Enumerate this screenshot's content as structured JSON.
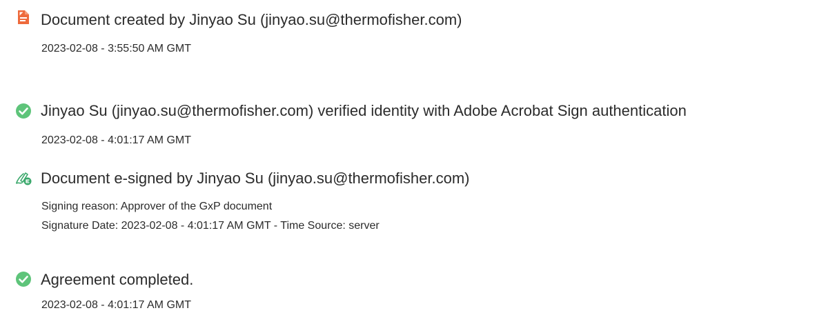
{
  "colors": {
    "created_icon": "#ee6a3c",
    "verified_icon": "#5ec47a",
    "signed_icon": "#3aa86b",
    "text": "#2b2b2b"
  },
  "events": [
    {
      "icon": "document-created-icon",
      "title": "Document created by Jinyao Su (jinyao.su@thermofisher.com)",
      "details": [
        "2023-02-08 - 3:55:50 AM GMT"
      ]
    },
    {
      "icon": "verified-check-icon",
      "title": "Jinyao Su (jinyao.su@thermofisher.com) verified identity with Adobe Acrobat Sign authentication",
      "details": [
        "2023-02-08 - 4:01:17 AM GMT"
      ]
    },
    {
      "icon": "e-signed-pen-icon",
      "title": "Document e-signed by Jinyao Su (jinyao.su@thermofisher.com)",
      "details": [
        "Signing reason: Approver of the GxP document",
        "Signature Date: 2023-02-08 - 4:01:17 AM GMT - Time Source: server"
      ]
    },
    {
      "icon": "completed-check-icon",
      "title": "Agreement completed.",
      "details": [
        "2023-02-08 - 4:01:17 AM GMT"
      ]
    }
  ]
}
